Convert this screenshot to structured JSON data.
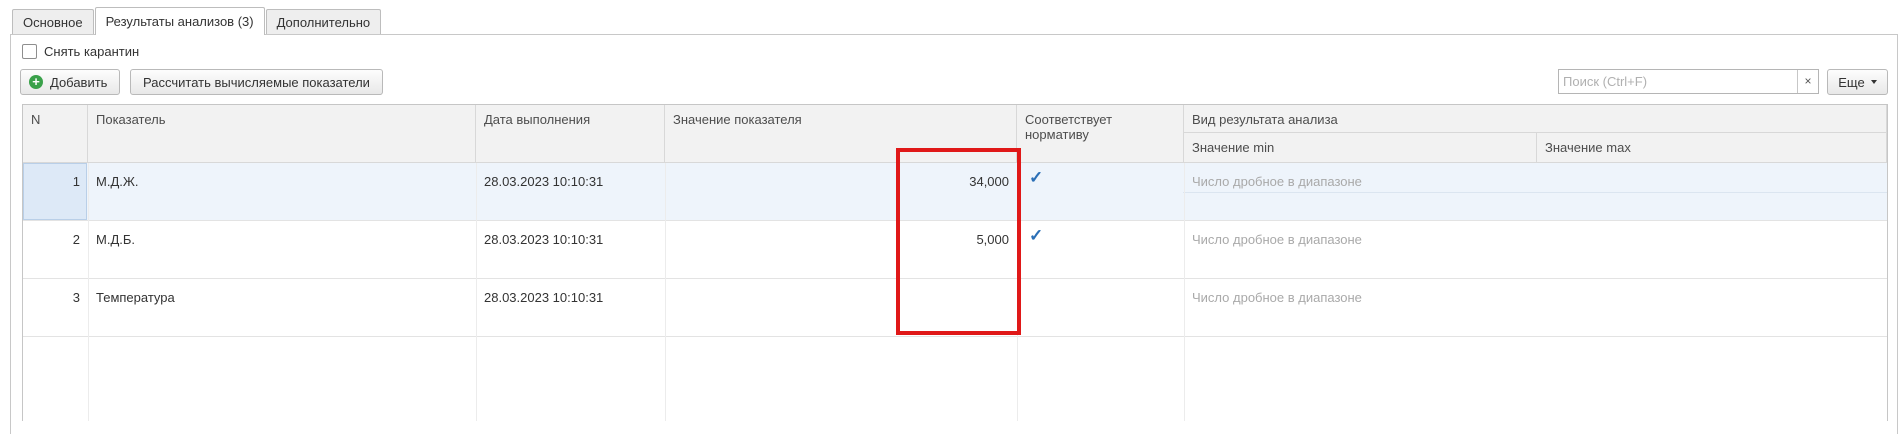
{
  "tabs": [
    {
      "label": "Основное"
    },
    {
      "label": "Результаты анализов (3)"
    },
    {
      "label": "Дополнительно"
    }
  ],
  "quarantine_checkbox": {
    "label": "Снять карантин",
    "checked": false
  },
  "toolbar": {
    "add_label": "Добавить",
    "calc_label": "Рассчитать вычисляемые показатели",
    "search_placeholder": "Поиск (Ctrl+F)",
    "clear_glyph": "×",
    "more_label": "Еще"
  },
  "table": {
    "headers": {
      "n": "N",
      "indicator": "Показатель",
      "date": "Дата выполнения",
      "value": "Значение показателя",
      "norm": "Соответствует нормативу",
      "result_type": "Вид результата анализа",
      "min": "Значение min",
      "max": "Значение max"
    },
    "rows": [
      {
        "n": "1",
        "indicator": "М.Д.Ж.",
        "date": "28.03.2023 10:10:31",
        "value": "34,000",
        "norm": true,
        "result_type": "Число дробное в диапазоне"
      },
      {
        "n": "2",
        "indicator": "М.Д.Б.",
        "date": "28.03.2023 10:10:31",
        "value": "5,000",
        "norm": true,
        "result_type": "Число дробное в диапазоне"
      },
      {
        "n": "3",
        "indicator": "Температура",
        "date": "28.03.2023 10:10:31",
        "value": "",
        "norm": false,
        "result_type": "Число дробное в диапазоне"
      }
    ],
    "selected_row": 1
  },
  "check_glyph": "✓",
  "colors": {
    "accent_check": "#2b6fb6",
    "highlight_border": "#e01818",
    "selected_row": "#eef4fb",
    "add_icon": "#3aa14a"
  }
}
